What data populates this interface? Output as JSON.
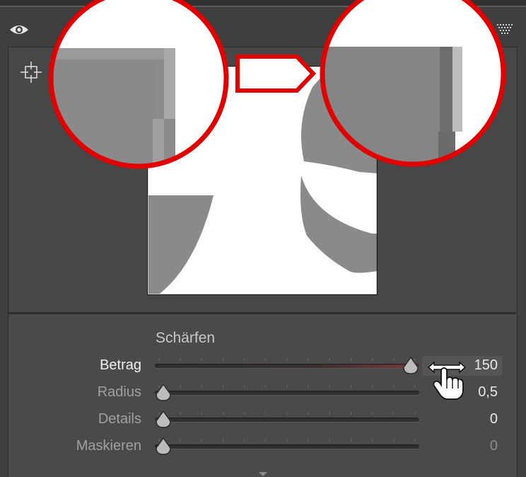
{
  "panel": {
    "section_title": "Schärfen"
  },
  "sliders": [
    {
      "label": "Betrag",
      "value": "150",
      "level": 1.0,
      "active": true
    },
    {
      "label": "Radius",
      "value": "0,5",
      "level": 0.0,
      "active": false
    },
    {
      "label": "Details",
      "value": "0",
      "level": 0.0,
      "active": false
    },
    {
      "label": "Maskieren",
      "value": "0",
      "level": 0.0,
      "active": false,
      "dim": true
    }
  ],
  "icons": {
    "visibility": "eye-icon",
    "target": "crosshair-target-icon",
    "panel_menu": "triangle-menu-icon",
    "cursor": "hand-scrub-cursor-icon",
    "callout_arrow": "arrow-callout-icon"
  },
  "colors": {
    "highlight_red": "#e00000",
    "panel_bg": "#4a4a4a",
    "active_track": "#7a3a3a"
  }
}
